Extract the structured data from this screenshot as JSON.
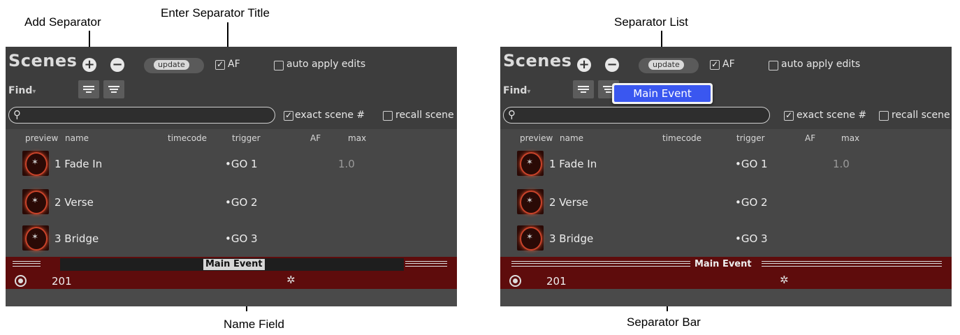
{
  "callouts": {
    "add_separator": "Add Separator",
    "enter_separator_title": "Enter Separator Title",
    "name_field": "Name Field",
    "separator_list": "Separator List",
    "separator_bar": "Separator Bar"
  },
  "panel": {
    "title": "Scenes",
    "add_glyph": "+",
    "remove_glyph": "−",
    "update_label": "update",
    "af_label": "AF",
    "auto_apply_label": "auto apply edits",
    "find_label": "Find",
    "find_arrow": "▾",
    "search_glyph": "⚲",
    "exact_scene_label": "exact scene #",
    "recall_scene_label": "recall scene",
    "checked_glyph": "✓",
    "columns": [
      "preview",
      "name",
      "timecode",
      "trigger",
      "AF",
      "max"
    ],
    "rows": [
      {
        "name": "1 Fade In",
        "trigger": "•GO 1",
        "max": "1.0"
      },
      {
        "name": "2 Verse",
        "trigger": "•GO 2",
        "max": ""
      },
      {
        "name": "3 Bridge",
        "trigger": "•GO 3",
        "max": ""
      }
    ],
    "separator_title": "Main Event",
    "footer_number": "201",
    "gear_glyph": "✲"
  },
  "dropdown": {
    "selected": "Main Event"
  },
  "colors": {
    "panel_bg": "#474747",
    "separator_red": "#5e0c0c",
    "dropdown_blue": "#3a57f0"
  }
}
